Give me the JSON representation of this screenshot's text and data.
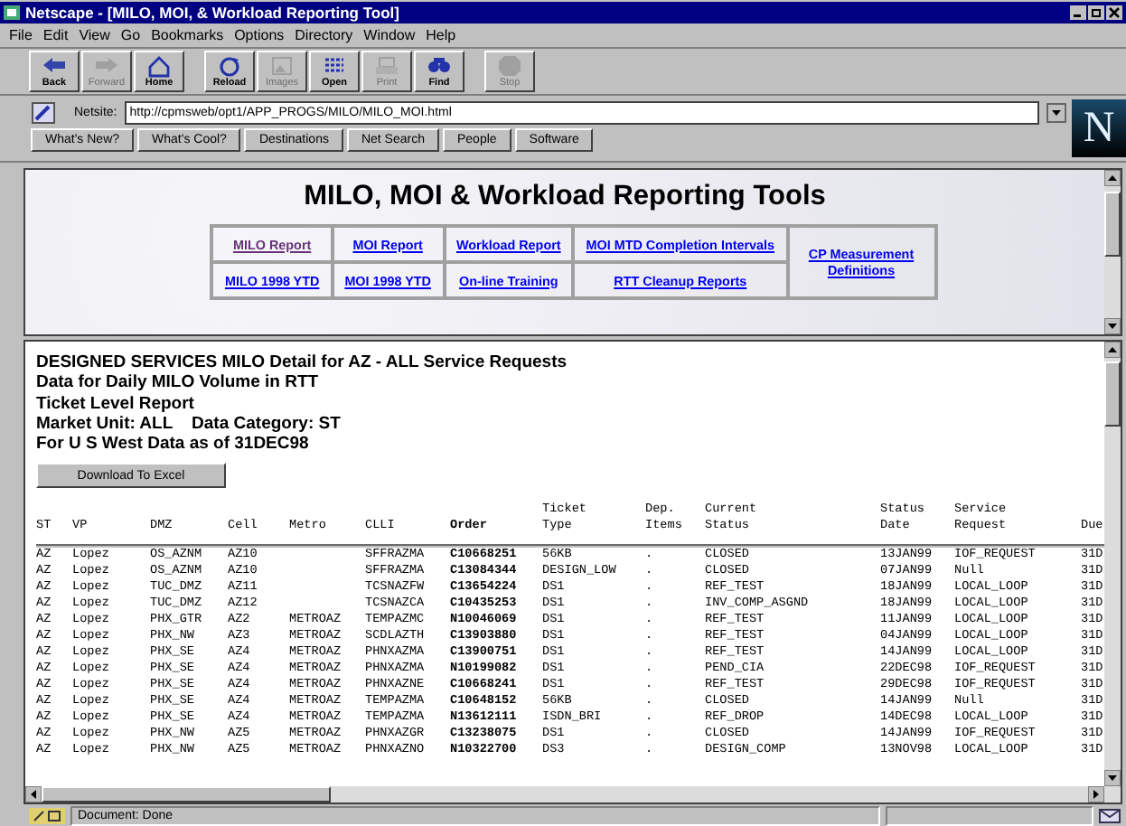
{
  "window": {
    "title": "Netscape - [MILO, MOI, & Workload Reporting Tool]"
  },
  "menu": [
    "File",
    "Edit",
    "View",
    "Go",
    "Bookmarks",
    "Options",
    "Directory",
    "Window",
    "Help"
  ],
  "toolbar": [
    {
      "label": "Back",
      "kind": "back",
      "disabled": false
    },
    {
      "label": "Forward",
      "kind": "forward",
      "disabled": true
    },
    {
      "label": "Home",
      "kind": "home",
      "disabled": false
    },
    {
      "label": "Reload",
      "kind": "reload",
      "disabled": false
    },
    {
      "label": "Images",
      "kind": "images",
      "disabled": true
    },
    {
      "label": "Open",
      "kind": "open",
      "disabled": false
    },
    {
      "label": "Print",
      "kind": "print",
      "disabled": true
    },
    {
      "label": "Find",
      "kind": "find",
      "disabled": false
    },
    {
      "label": "Stop",
      "kind": "stop",
      "disabled": true
    }
  ],
  "location": {
    "label": "Netsite:",
    "value": "http://cpmsweb/opt1/APP_PROGS/MILO/MILO_MOI.html"
  },
  "logo": "N",
  "directory_buttons": [
    "What's New?",
    "What's Cool?",
    "Destinations",
    "Net Search",
    "People",
    "Software"
  ],
  "top_frame": {
    "heading": "MILO, MOI & Workload Reporting Tools",
    "links": [
      {
        "label": "MILO Report",
        "visited": true
      },
      {
        "label": "MOI Report",
        "visited": false
      },
      {
        "label": "Workload Report",
        "visited": false
      },
      {
        "label": "MOI MTD Completion Intervals",
        "visited": false
      },
      {
        "label": "CP Measurement Definitions",
        "visited": false
      },
      {
        "label": "MILO 1998 YTD",
        "visited": false
      },
      {
        "label": "MOI 1998 YTD",
        "visited": false
      },
      {
        "label": "On-line Training",
        "visited": false
      },
      {
        "label": "RTT Cleanup Reports",
        "visited": false
      }
    ]
  },
  "report": {
    "lines": [
      "DESIGNED SERVICES MILO Detail for AZ - ALL Service Requests",
      "Data for Daily MILO Volume in RTT",
      "Ticket Level Report",
      "Market Unit: ALL    Data Category: ST",
      "For U S West Data as of 31DEC98"
    ],
    "button": "Download To Excel",
    "columns": [
      "ST",
      "VP",
      "DMZ",
      "Cell",
      "Metro",
      "CLLI",
      "Order",
      "Ticket Type",
      "Dep. Items",
      "Current Status",
      "Status Date",
      "Service Request",
      "Due"
    ],
    "rows": [
      [
        "AZ",
        "Lopez",
        "OS_AZNM",
        "AZ10",
        "",
        "SFFRAZMA",
        "C10668251",
        "56KB",
        ".",
        "CLOSED",
        "13JAN99",
        "IOF_REQUEST",
        "31D"
      ],
      [
        "AZ",
        "Lopez",
        "OS_AZNM",
        "AZ10",
        "",
        "SFFRAZMA",
        "C13084344",
        "DESIGN_LOW",
        ".",
        "CLOSED",
        "07JAN99",
        "Null",
        "31D"
      ],
      [
        "AZ",
        "Lopez",
        "TUC_DMZ",
        "AZ11",
        "",
        "TCSNAZFW",
        "C13654224",
        "DS1",
        ".",
        "REF_TEST",
        "18JAN99",
        "LOCAL_LOOP",
        "31D"
      ],
      [
        "AZ",
        "Lopez",
        "TUC_DMZ",
        "AZ12",
        "",
        "TCSNAZCA",
        "C10435253",
        "DS1",
        ".",
        "INV_COMP_ASGND",
        "18JAN99",
        "LOCAL_LOOP",
        "31D"
      ],
      [
        "AZ",
        "Lopez",
        "PHX_GTR",
        "AZ2",
        "METROAZ",
        "TEMPAZMC",
        "N10046069",
        "DS1",
        ".",
        "REF_TEST",
        "11JAN99",
        "LOCAL_LOOP",
        "31D"
      ],
      [
        "AZ",
        "Lopez",
        "PHX_NW",
        "AZ3",
        "METROAZ",
        "SCDLAZTH",
        "C13903880",
        "DS1",
        ".",
        "REF_TEST",
        "04JAN99",
        "LOCAL_LOOP",
        "31D"
      ],
      [
        "AZ",
        "Lopez",
        "PHX_SE",
        "AZ4",
        "METROAZ",
        "PHNXAZMA",
        "C13900751",
        "DS1",
        ".",
        "REF_TEST",
        "14JAN99",
        "LOCAL_LOOP",
        "31D"
      ],
      [
        "AZ",
        "Lopez",
        "PHX_SE",
        "AZ4",
        "METROAZ",
        "PHNXAZMA",
        "N10199082",
        "DS1",
        ".",
        "PEND_CIA",
        "22DEC98",
        "IOF_REQUEST",
        "31D"
      ],
      [
        "AZ",
        "Lopez",
        "PHX_SE",
        "AZ4",
        "METROAZ",
        "PHNXAZNE",
        "C10668241",
        "DS1",
        ".",
        "REF_TEST",
        "29DEC98",
        "IOF_REQUEST",
        "31D"
      ],
      [
        "AZ",
        "Lopez",
        "PHX_SE",
        "AZ4",
        "METROAZ",
        "TEMPAZMA",
        "C10648152",
        "56KB",
        ".",
        "CLOSED",
        "14JAN99",
        "Null",
        "31D"
      ],
      [
        "AZ",
        "Lopez",
        "PHX_SE",
        "AZ4",
        "METROAZ",
        "TEMPAZMA",
        "N13612111",
        "ISDN_BRI",
        ".",
        "REF_DROP",
        "14DEC98",
        "LOCAL_LOOP",
        "31D"
      ],
      [
        "AZ",
        "Lopez",
        "PHX_NW",
        "AZ5",
        "METROAZ",
        "PHNXAZGR",
        "C13238075",
        "DS1",
        ".",
        "CLOSED",
        "14JAN99",
        "IOF_REQUEST",
        "31D"
      ],
      [
        "AZ",
        "Lopez",
        "PHX_NW",
        "AZ5",
        "METROAZ",
        "PHNXAZNO",
        "N10322700",
        "DS3",
        ".",
        "DESIGN_COMP",
        "13NOV98",
        "LOCAL_LOOP",
        "31D"
      ]
    ]
  },
  "status_bar": {
    "text": "Document: Done"
  }
}
